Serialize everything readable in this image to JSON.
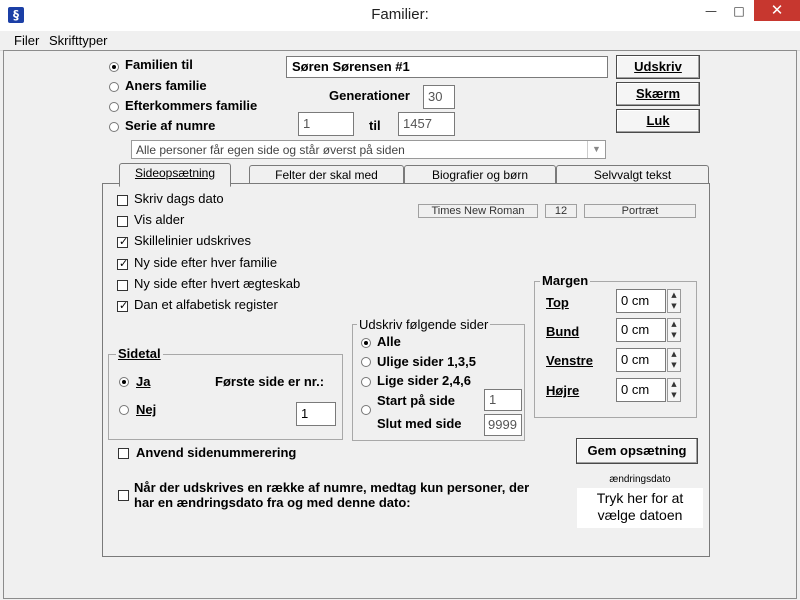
{
  "window": {
    "title": "Familier:",
    "minimize": "—",
    "maximize": "□",
    "close": "✕"
  },
  "menu": [
    "Filer",
    "Skrifttyper"
  ],
  "report_type": {
    "options": [
      "Familien til",
      "Aners familie",
      "Efterkommers familie",
      "Serie af numre"
    ],
    "selected": 0,
    "person": "Søren Sørensen  #1",
    "generations_label": "Generationer",
    "generations": "30",
    "from": "1",
    "to_label": "til",
    "to": "1457",
    "mode_select": "Alle personer får egen side og står øverst på siden"
  },
  "buttons": {
    "print": "Udskriv",
    "screen": "Skærm",
    "close": "Luk",
    "save": "Gem opsætning"
  },
  "tabs": [
    "Sideopsætning",
    "Felter der skal med",
    "Biografier og børn",
    "Selvvalgt tekst"
  ],
  "active_tab": 0,
  "font_info": {
    "font": "Times New Roman",
    "size": "12",
    "orientation": "Portræt"
  },
  "options": [
    {
      "label": "Skriv dags dato",
      "checked": false
    },
    {
      "label": "Vis alder",
      "checked": false
    },
    {
      "label": "Skillelinier udskrives",
      "checked": true
    },
    {
      "label": "Ny side efter hver familie",
      "checked": true
    },
    {
      "label": "Ny side efter hvert ægteskab",
      "checked": false
    },
    {
      "label": "Dan et alfabetisk register",
      "checked": true
    }
  ],
  "margins": {
    "title": "Margen",
    "rows": [
      {
        "label": "Top",
        "value": "0 cm"
      },
      {
        "label": "Bund",
        "value": "0 cm"
      },
      {
        "label": "Venstre",
        "value": "0 cm"
      },
      {
        "label": "Højre",
        "value": "0 cm"
      }
    ]
  },
  "print_pages": {
    "title": "Udskriv følgende sider",
    "options": [
      "Alle",
      "Ulige sider 1,3,5",
      "Lige sider 2,4,6",
      "Start på side"
    ],
    "selected": 0,
    "start": "1",
    "end_label": "Slut med side",
    "end": "9999"
  },
  "pagenum": {
    "title": "Sidetal",
    "options": [
      "Ja",
      "Nej"
    ],
    "selected": 0,
    "first_label": "Første side er nr.:",
    "first": "1"
  },
  "apply_numbering": {
    "label": "Anvend sidenummerering",
    "checked": false
  },
  "date_filter": {
    "label_1": "Når der udskrives en række af numre, medtag kun personer, der",
    "label_2": "har en ændringsdato fra og med denne dato:",
    "checked": false,
    "caption": "ændringsdato",
    "button_1": "Tryk her for at",
    "button_2": "vælge datoen"
  }
}
